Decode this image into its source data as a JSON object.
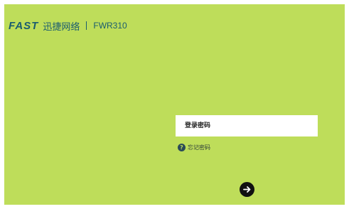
{
  "header": {
    "brand": "FAST",
    "brand_cn": "迅捷网络",
    "model": "FWR310"
  },
  "login": {
    "password_placeholder": "登录密码",
    "forgot_label": "忘记密码",
    "help_glyph": "?",
    "submit_icon": "arrow-right-icon"
  },
  "colors": {
    "background": "#bedd5a",
    "brand": "#1a5c6f",
    "button": "#111111"
  }
}
